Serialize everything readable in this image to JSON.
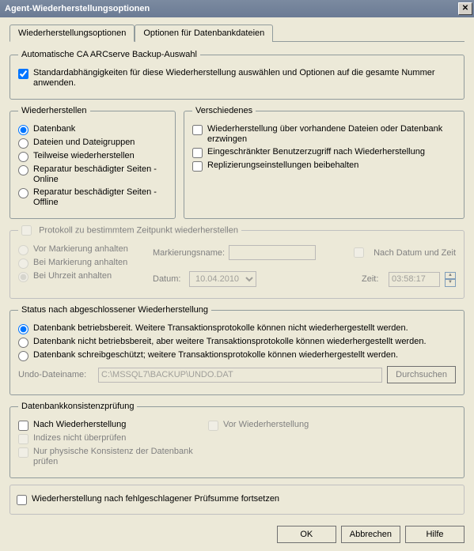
{
  "title": "Agent-Wiederherstellungsoptionen",
  "tabs": {
    "restore": "Wiederherstellungsoptionen",
    "dbfiles": "Optionen für Datenbankdateien"
  },
  "auto": {
    "legend": "Automatische CA ARCserve Backup-Auswahl",
    "label": "Standardabhängigkeiten für diese Wiederherstellung auswählen und Optionen auf die gesamte Nummer anwenden."
  },
  "restore": {
    "legend": "Wiederherstellen",
    "opt_db": "Datenbank",
    "opt_files": "Dateien und Dateigruppen",
    "opt_partial": "Teilweise wiederherstellen",
    "opt_repair_online": "Reparatur beschädigter Seiten - Online",
    "opt_repair_offline": "Reparatur beschädigter Seiten - Offline"
  },
  "misc": {
    "legend": "Verschiedenes",
    "force": "Wiederherstellung über vorhandene Dateien oder Datenbank erzwingen",
    "restricted": "Eingeschränkter Benutzerzugriff nach Wiederherstellung",
    "replication": "Replizierungseinstellungen beibehalten"
  },
  "pit": {
    "chk": "Protokoll zu bestimmtem Zeitpunkt wiederherstellen",
    "before_mark": "Vor Markierung anhalten",
    "at_mark": "Bei Markierung anhalten",
    "at_time": "Bei Uhrzeit anhalten",
    "mark_label": "Markierungsname:",
    "after_dt": "Nach Datum und Zeit",
    "date_label": "Datum:",
    "date_val": "10.04.2010",
    "time_label": "Zeit:",
    "time_val": "03:58:17"
  },
  "status": {
    "legend": "Status nach abgeschlossener Wiederherstellung",
    "opt_ready": "Datenbank betriebsbereit. Weitere Transaktionsprotokolle können nicht wiederhergestellt werden.",
    "opt_notready": "Datenbank nicht betriebsbereit, aber weitere Transaktionsprotokolle können wiederhergestellt werden.",
    "opt_readonly": "Datenbank schreibgeschützt; weitere Transaktionsprotokolle können wiederhergestellt werden.",
    "undo_label": "Undo-Dateiname:",
    "undo_val": "C:\\MSSQL7\\BACKUP\\UNDO.DAT",
    "browse": "Durchsuchen"
  },
  "dbcc": {
    "legend": "Datenbankkonsistenzprüfung",
    "after": "Nach Wiederherstellung",
    "before": "Vor Wiederherstellung",
    "noindex": "Indizes nicht überprüfen",
    "physonly": "Nur physische Konsistenz der Datenbank prüfen"
  },
  "checksum": "Wiederherstellung nach fehlgeschlagener Prüfsumme fortsetzen",
  "buttons": {
    "ok": "OK",
    "cancel": "Abbrechen",
    "help": "Hilfe"
  }
}
